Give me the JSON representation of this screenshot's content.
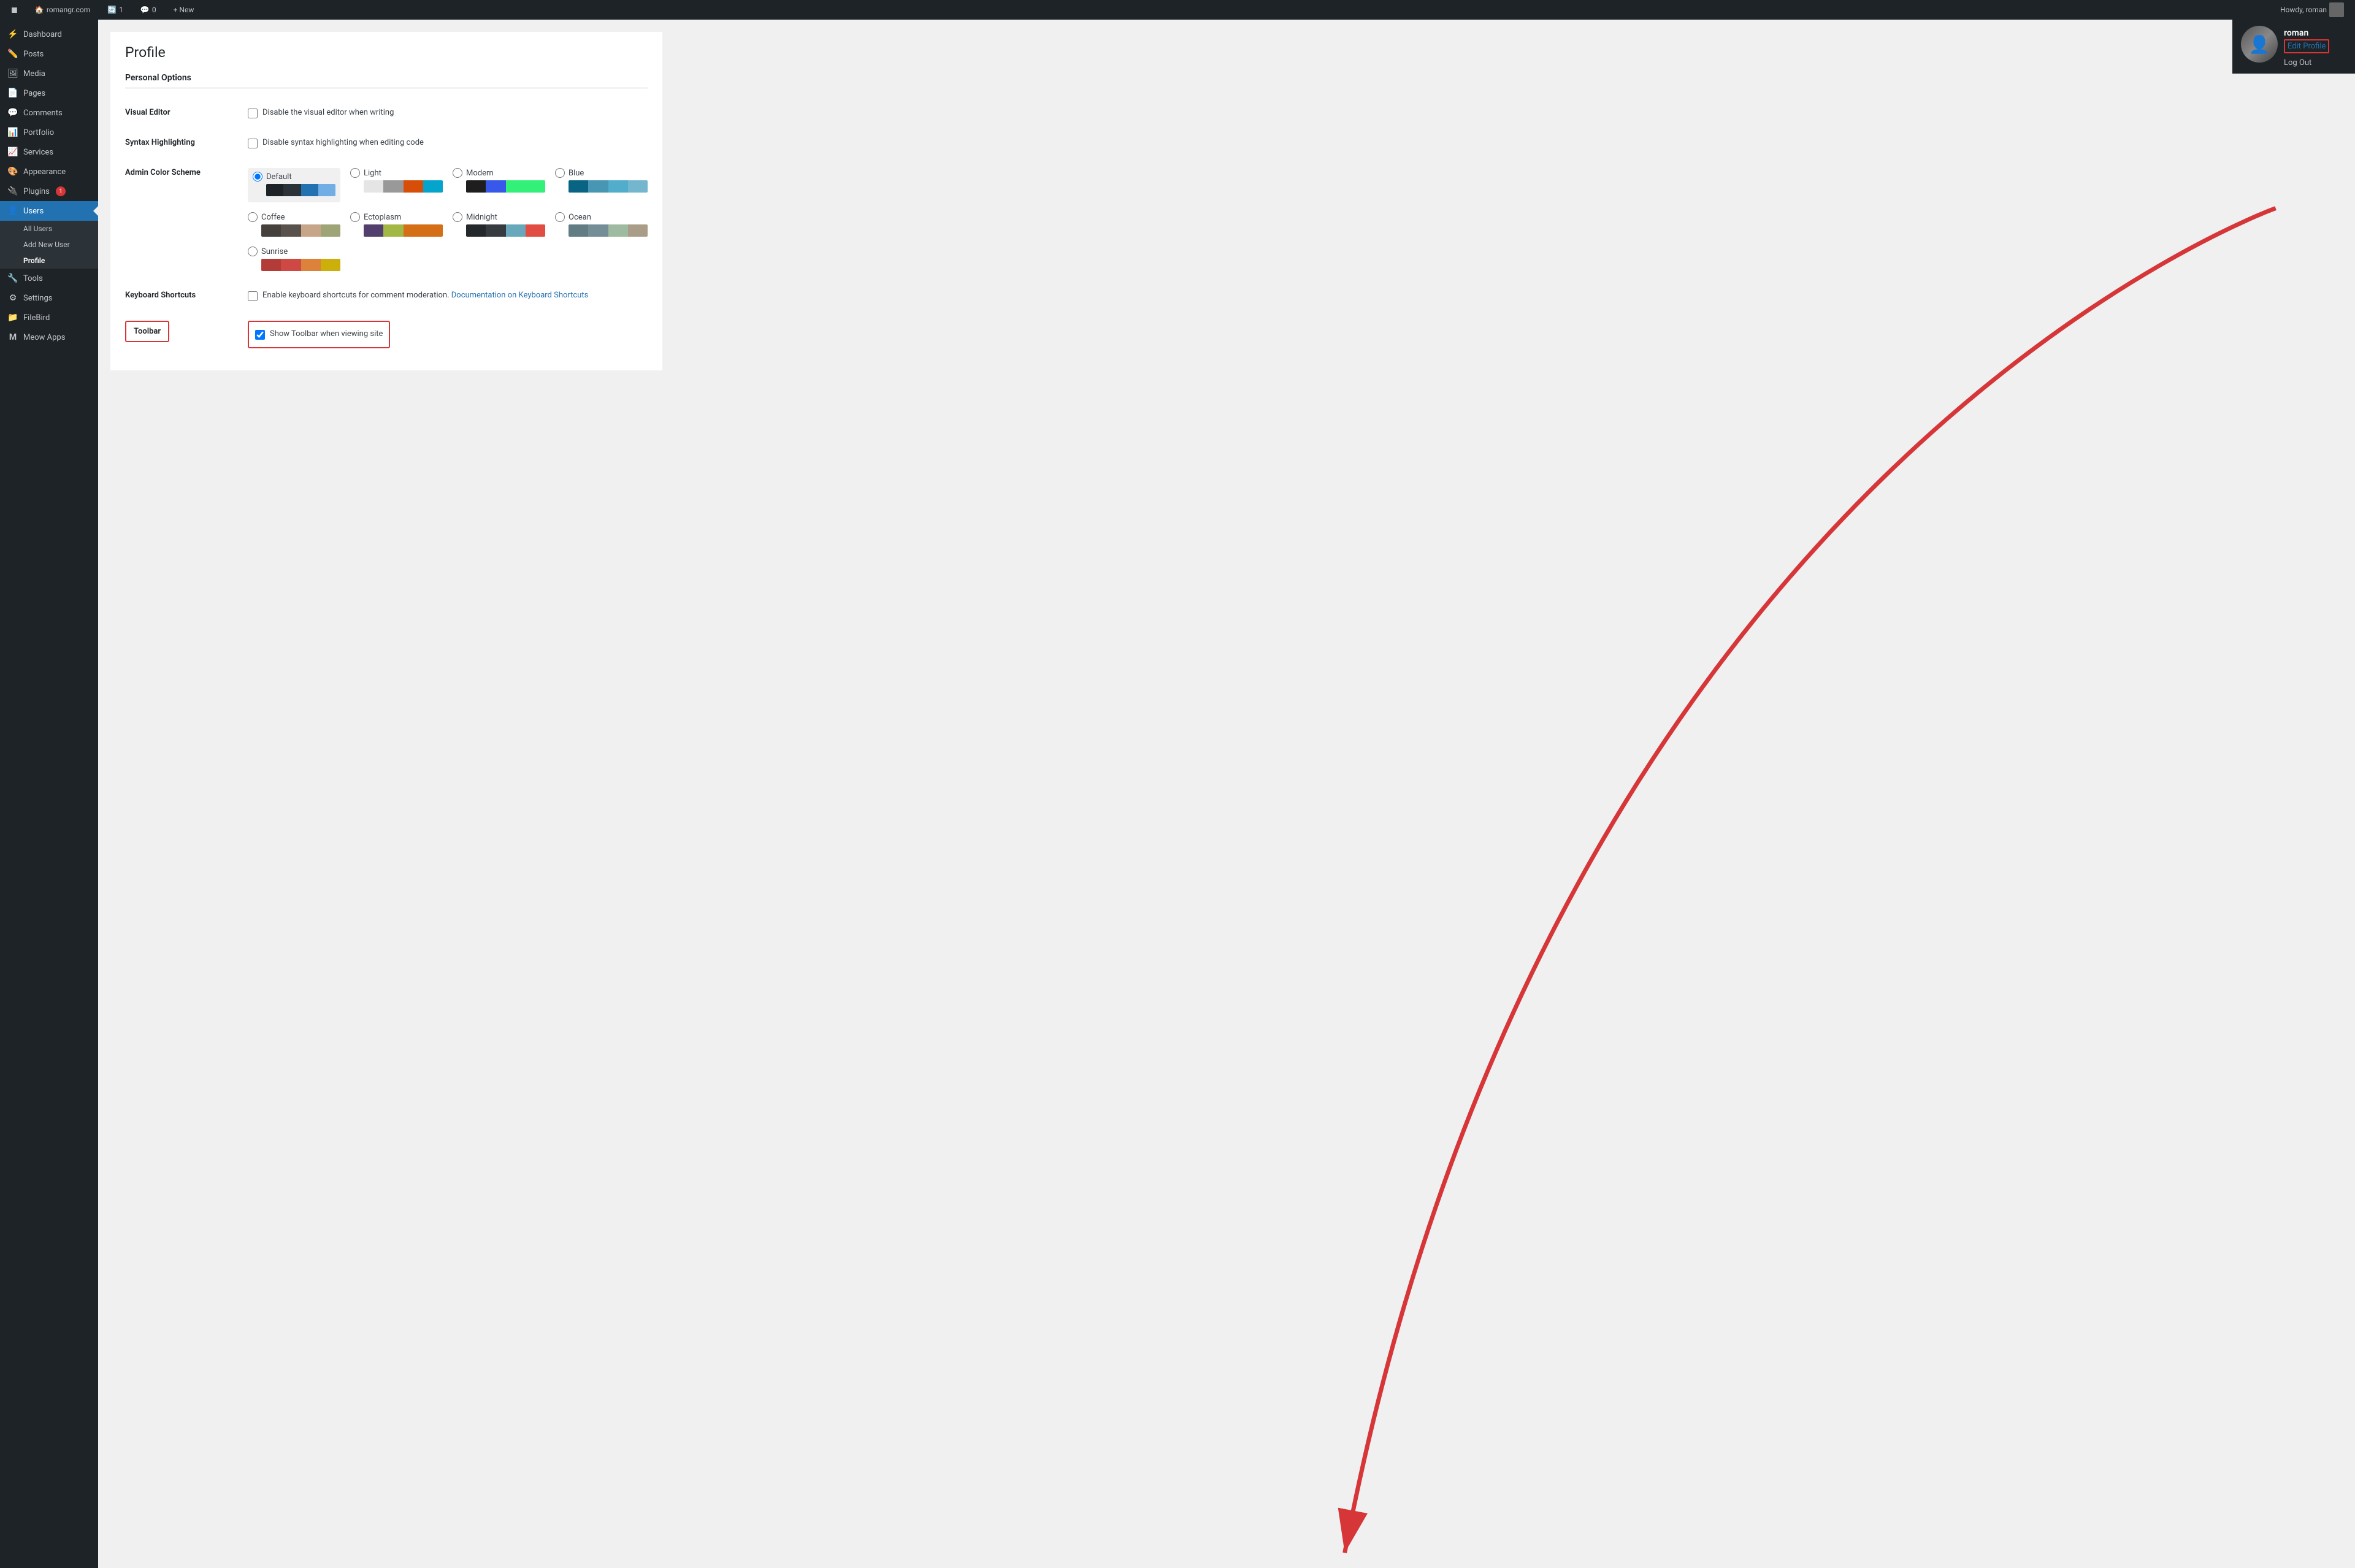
{
  "adminbar": {
    "site_name": "romangr.com",
    "updates_count": "1",
    "comments_count": "0",
    "new_label": "+ New",
    "howdy": "Howdy, roman",
    "site_icon": "🏠",
    "wp_icon": "W"
  },
  "sidebar": {
    "items": [
      {
        "id": "dashboard",
        "label": "Dashboard",
        "icon": "⚡"
      },
      {
        "id": "posts",
        "label": "Posts",
        "icon": "📝"
      },
      {
        "id": "media",
        "label": "Media",
        "icon": "🖼"
      },
      {
        "id": "pages",
        "label": "Pages",
        "icon": "📄"
      },
      {
        "id": "comments",
        "label": "Comments",
        "icon": "💬"
      },
      {
        "id": "portfolio",
        "label": "Portfolio",
        "icon": "📊"
      },
      {
        "id": "services",
        "label": "Services",
        "icon": "📈"
      },
      {
        "id": "appearance",
        "label": "Appearance",
        "icon": "🎨"
      },
      {
        "id": "plugins",
        "label": "Plugins",
        "icon": "🔌",
        "badge": "1"
      },
      {
        "id": "users",
        "label": "Users",
        "icon": "👤",
        "active": true
      },
      {
        "id": "tools",
        "label": "Tools",
        "icon": "🔧"
      },
      {
        "id": "settings",
        "label": "Settings",
        "icon": "⚙"
      },
      {
        "id": "filebird",
        "label": "FileBird",
        "icon": "📁"
      },
      {
        "id": "meowapps",
        "label": "Meow Apps",
        "icon": "M"
      }
    ],
    "users_submenu": [
      {
        "id": "all-users",
        "label": "All Users"
      },
      {
        "id": "add-new-user",
        "label": "Add New User"
      },
      {
        "id": "profile",
        "label": "Profile",
        "active": true
      }
    ]
  },
  "page": {
    "title": "Profile",
    "section": "Personal Options"
  },
  "form": {
    "visual_editor": {
      "label": "Visual Editor",
      "checkbox_label": "Disable the visual editor when writing",
      "checked": false
    },
    "syntax_highlighting": {
      "label": "Syntax Highlighting",
      "checkbox_label": "Disable syntax highlighting when editing code",
      "checked": false
    },
    "admin_color_scheme": {
      "label": "Admin Color Scheme",
      "schemes": [
        {
          "id": "default",
          "label": "Default",
          "selected": true,
          "swatches": [
            "#1d2327",
            "#2c3338",
            "#2271b1",
            "#72aee6"
          ]
        },
        {
          "id": "light",
          "label": "Light",
          "selected": false,
          "swatches": [
            "#e5e5e5",
            "#999",
            "#d64e07",
            "#04a4cc"
          ]
        },
        {
          "id": "modern",
          "label": "Modern",
          "selected": false,
          "swatches": [
            "#1e1e1e",
            "#3858e9",
            "#33f078",
            "#33f078"
          ]
        },
        {
          "id": "blue",
          "label": "Blue",
          "selected": false,
          "swatches": [
            "#096484",
            "#4796b3",
            "#52accc",
            "#74b6ce"
          ]
        },
        {
          "id": "coffee",
          "label": "Coffee",
          "selected": false,
          "swatches": [
            "#46403c",
            "#59524c",
            "#c7a589",
            "#9ea476"
          ]
        },
        {
          "id": "ectoplasm",
          "label": "Ectoplasm",
          "selected": false,
          "swatches": [
            "#523f6d",
            "#a3b745",
            "#d46f15",
            "#d46f15"
          ]
        },
        {
          "id": "midnight",
          "label": "Midnight",
          "selected": false,
          "swatches": [
            "#25282b",
            "#363b3f",
            "#69a8bb",
            "#e14d43"
          ]
        },
        {
          "id": "ocean",
          "label": "Ocean",
          "selected": false,
          "swatches": [
            "#627c83",
            "#738e96",
            "#9ebaa0",
            "#aa9d88"
          ]
        },
        {
          "id": "sunrise",
          "label": "Sunrise",
          "selected": false,
          "swatches": [
            "#b43c38",
            "#cf4944",
            "#dd823b",
            "#ccaf0b"
          ]
        }
      ]
    },
    "keyboard_shortcuts": {
      "label": "Keyboard Shortcuts",
      "checkbox_label": "Enable keyboard shortcuts for comment moderation.",
      "link_text": "Documentation on Keyboard Shortcuts",
      "checked": false
    },
    "toolbar": {
      "label": "Toolbar",
      "checkbox_label": "Show Toolbar when viewing site",
      "checked": true
    }
  },
  "user_dropdown": {
    "username": "roman",
    "edit_profile_label": "Edit Profile",
    "logout_label": "Log Out"
  },
  "annotation": {
    "arrow_color": "#d63638"
  }
}
